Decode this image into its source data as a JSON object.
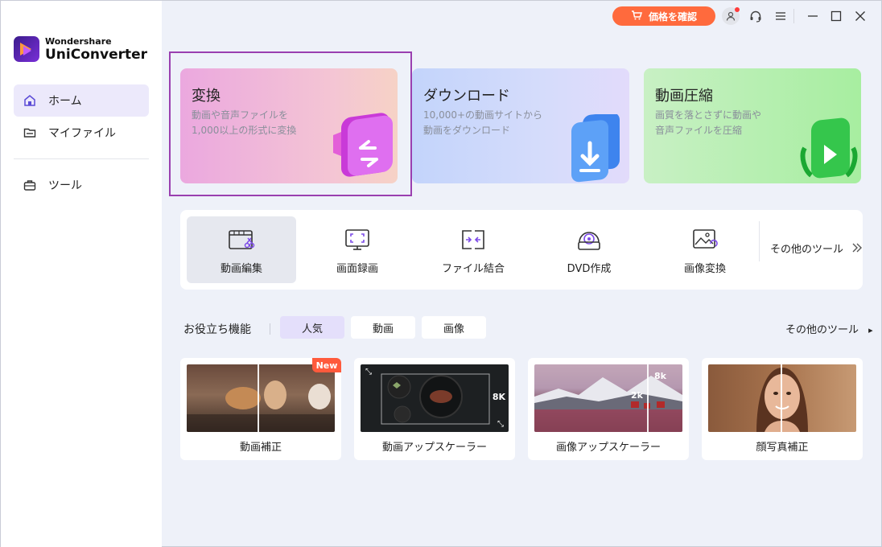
{
  "app": {
    "brand": "Wondershare",
    "product": "UniConverter"
  },
  "sidebar": {
    "items": [
      {
        "label": "ホーム",
        "icon": "home-icon",
        "active": true
      },
      {
        "label": "マイファイル",
        "icon": "folder-icon",
        "active": false
      },
      {
        "label": "ツール",
        "icon": "toolbox-icon",
        "active": false
      }
    ]
  },
  "topbar": {
    "price_button": "価格を確認",
    "icons": [
      "cart-icon",
      "user-icon",
      "headset-icon",
      "menu-icon",
      "minimize-icon",
      "maximize-icon",
      "close-icon"
    ]
  },
  "cards": [
    {
      "title": "変換",
      "desc": "動画や音声ファイルを1,000以上の形式に変換",
      "selected": true
    },
    {
      "title": "ダウンロード",
      "desc": "10,000+の動画サイトから動画をダウンロード"
    },
    {
      "title": "動画圧縮",
      "desc": "画質を落とさずに動画や音声ファイルを圧縮"
    }
  ],
  "tools": {
    "items": [
      {
        "label": "動画編集",
        "icon": "video-edit-icon",
        "active": true
      },
      {
        "label": "画面録画",
        "icon": "screen-record-icon"
      },
      {
        "label": "ファイル結合",
        "icon": "merge-icon"
      },
      {
        "label": "DVD作成",
        "icon": "dvd-icon"
      },
      {
        "label": "画像変換",
        "icon": "image-convert-icon"
      }
    ],
    "more": "その他のツール"
  },
  "features": {
    "label": "お役立ち機能",
    "tabs": [
      "人気",
      "動画",
      "画像"
    ],
    "active_tab": "人気",
    "more": "その他のツール",
    "cards": [
      {
        "label": "動画補正",
        "badge": "New"
      },
      {
        "label": "動画アップスケーラー",
        "tag": "8K"
      },
      {
        "label": "画像アップスケーラー",
        "tags": [
          "8k",
          "2k"
        ]
      },
      {
        "label": "顔写真補正"
      }
    ]
  },
  "colors": {
    "accent": "#ff6a3d",
    "selection": "#9a3fb0",
    "active_nav": "#ece9fb"
  }
}
